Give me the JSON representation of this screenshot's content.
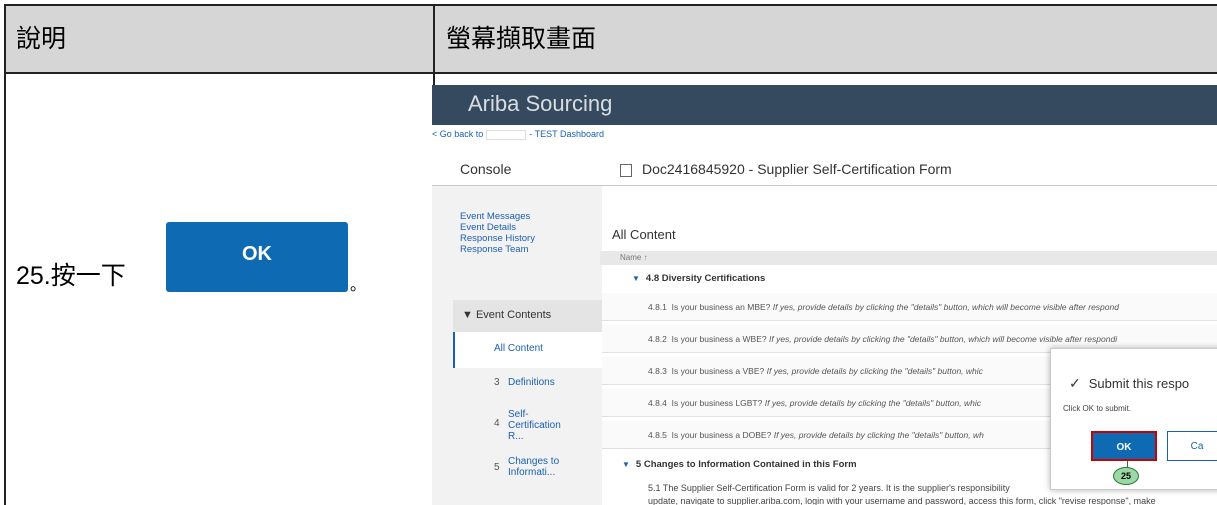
{
  "header": {
    "col1": "說明",
    "col2": "螢幕擷取畫面"
  },
  "step": {
    "text": "25.按一下",
    "button_label": "OK",
    "period": "。"
  },
  "app": {
    "title": "Ariba Sourcing",
    "go_back_prefix": "< Go back to",
    "go_back_suffix": "- TEST Dashboard",
    "console": "Console",
    "doc_title": "Doc2416845920 - Supplier Self-Certification Form",
    "left_links": [
      "Event Messages",
      "Event Details",
      "Response History",
      "Response Team"
    ],
    "event_contents": "▼ Event Contents",
    "all_content_nav": "All Content",
    "tree": [
      {
        "num": "3",
        "label": "Definitions"
      },
      {
        "num": "4",
        "label": "Self-Certification R..."
      },
      {
        "num": "5",
        "label": "Changes to Informati..."
      }
    ],
    "all_content_heading": "All Content",
    "name_header": "Name ↑",
    "section_48": "4.8  Diversity Certifications",
    "questions": [
      {
        "num": "4.8.1",
        "text": "Is your business an MBE?",
        "hint": "If yes, provide details by clicking the \"details\" button, which will become visible after respond"
      },
      {
        "num": "4.8.2",
        "text": "Is your business a WBE?",
        "hint": "If yes, provide details by clicking the \"details\" button, which will become visible after respondi"
      },
      {
        "num": "4.8.3",
        "text": "Is your business a VBE?",
        "hint": "If yes, provide details by clicking the \"details\" button, whic"
      },
      {
        "num": "4.8.4",
        "text": "Is your business LGBT?",
        "hint": "If yes, provide details by clicking the \"details\" button, whic"
      },
      {
        "num": "4.8.5",
        "text": "Is your business a DOBE?",
        "hint": "If yes, provide details by clicking the \"details\" button, wh"
      }
    ],
    "section_5": "5  Changes to Information Contained in this Form",
    "body_51": "5.1  The Supplier Self-Certification Form is valid for 2 years. It is the supplier's responsibility",
    "body_51b": "update, navigate to supplier.ariba.com, login with your username and password, access this form, click \"revise response\", make"
  },
  "dialog": {
    "title": "Submit this respo",
    "message": "Click OK to submit.",
    "ok": "OK",
    "cancel": "Ca",
    "callout": "25"
  },
  "colors": {
    "shell": "#354a5f",
    "primary": "#0f6ab4",
    "link": "#1a5fb4",
    "highlight": "#cc0000",
    "callout": "#9bd9a4"
  }
}
